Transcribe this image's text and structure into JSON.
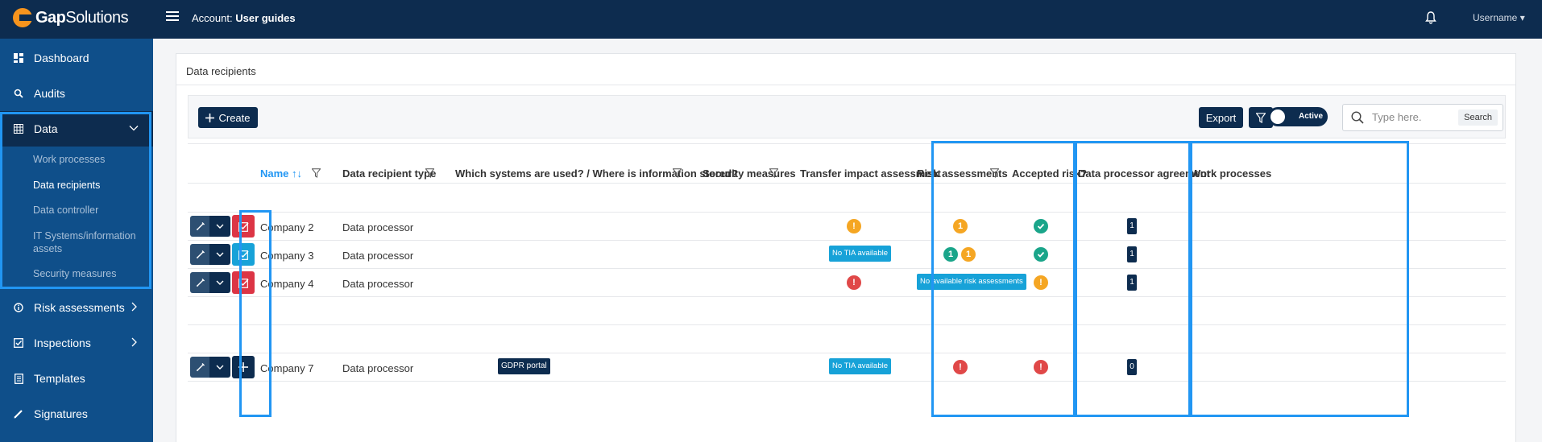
{
  "header": {
    "logo_bold": "Gap",
    "logo_regular": "Solutions",
    "account_label": "Account:",
    "account_name": "User guides",
    "user": "Username ▾"
  },
  "sidebar": {
    "items": {
      "dashboard": "Dashboard",
      "audits": "Audits",
      "data": "Data",
      "risk": "Risk assessments",
      "inspections": "Inspections",
      "templates": "Templates",
      "signatures": "Signatures"
    },
    "data_sub": {
      "work_processes": "Work processes",
      "data_recipients": "Data recipients",
      "data_controller": "Data controller",
      "it_systems_1": "IT Systems/information",
      "it_systems_2": "assets",
      "security_measures": "Security measures"
    }
  },
  "panel": {
    "title": "Data recipients",
    "create_label": "Create",
    "export_label": "Export",
    "toggle_label": "Active",
    "search_placeholder": "Type here.",
    "search_button": "Search"
  },
  "columns": {
    "name": "Name",
    "type": "Data recipient type",
    "systems": "Which systems are used? / Where is information stored?",
    "security": "Security measures",
    "tia": "Transfer impact assessment",
    "risk": "Risk assessments",
    "accepted": "Accepted risk?",
    "dpa": "Data processor agreement",
    "work": "Work processes"
  },
  "rows": {
    "r2": {
      "name": "Company 2",
      "type": "Data processor",
      "tia_count": "!",
      "risk_count": "1",
      "dpa": "1"
    },
    "r3": {
      "name": "Company 3",
      "type": "Data processor",
      "tia_tag": "No TIA available",
      "risk_green": "1",
      "risk_orange": "1",
      "dpa": "1"
    },
    "r4": {
      "name": "Company 4",
      "type": "Data processor",
      "tia_count": "!",
      "risk_tag": "No available risk assessments",
      "accepted": "!",
      "dpa": "1"
    },
    "r7": {
      "name": "Company 7",
      "type": "Data processor",
      "systems_tag": "GDPR portal",
      "tia_tag": "No TIA available",
      "risk_count": "!",
      "accepted": "!",
      "dpa": "0"
    }
  },
  "colors": {
    "navy": "#0d2c4f",
    "sidebar": "#0f4f8a",
    "accent": "#2196f3",
    "orange": "#f5a623",
    "green": "#1aa58a",
    "red": "#e04848",
    "cyan": "#17a2d8",
    "inspect_red": "#dc3545"
  },
  "icons": [
    "hamburger-icon",
    "bell-icon",
    "dashboard-icon",
    "search-icon",
    "table-icon",
    "info-icon",
    "checkbox-icon",
    "document-icon",
    "pen-icon",
    "filter-icon",
    "pencil-icon",
    "chevron-down-icon",
    "plus-icon",
    "check-icon",
    "sort-asc-icon"
  ]
}
